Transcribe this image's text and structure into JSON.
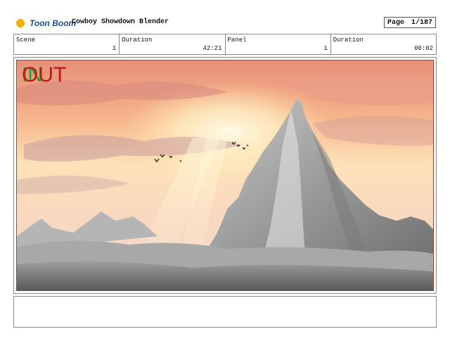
{
  "header": {
    "logo_text": "Toon Boom",
    "project_title": "Cowboy Showdown Blender",
    "page_label": "Page",
    "page_value": "1/187"
  },
  "info": {
    "scene_label": "Scene",
    "scene_value": "1",
    "duration_label": "Duration",
    "duration_value": "42:21",
    "panel_label": "Panel",
    "panel_value": "1",
    "panel_duration_label": "Duration",
    "panel_duration_value": "00:02"
  },
  "panel": {
    "in_marker": "IN",
    "out_marker": "OUT",
    "in_color": "#2a9d2a",
    "out_color": "#c0141e"
  },
  "notes": {
    "text": ""
  },
  "icons": [
    "toon-boom-logo-icon"
  ]
}
